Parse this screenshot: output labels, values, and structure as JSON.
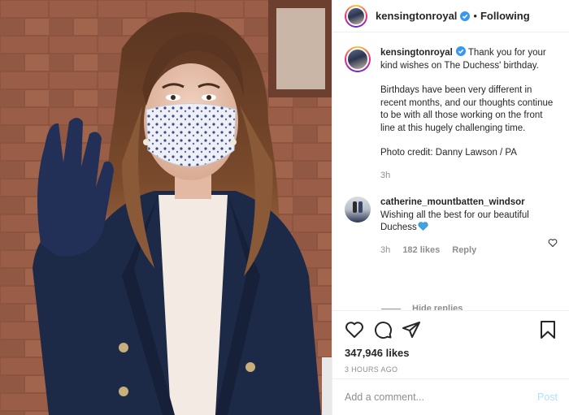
{
  "post": {
    "username": "kensingtonroyal",
    "separator": "•",
    "follow_status": "Following",
    "caption": {
      "username": "kensingtonroyal",
      "paragraphs": [
        "Thank you for your kind wishes on The Duchess' birthday.",
        "Birthdays have been very different in recent months, and our thoughts continue to be with all those working on the front line at this hugely challenging time.",
        "Photo credit: Danny Lawson / PA"
      ],
      "time": "3h"
    },
    "comments": [
      {
        "username": "catherine_mountbatten_windsor",
        "text": "Wishing all the best for our beautiful Duchess",
        "time": "3h",
        "likes": "182 likes",
        "reply_label": "Reply"
      }
    ],
    "hide_replies_label": "Hide replies",
    "likes_count": "347,946 likes",
    "timestamp": "3 HOURS AGO",
    "add_comment_placeholder": "Add a comment...",
    "post_button": "Post"
  },
  "icons": {
    "verified": "verified-badge-icon",
    "heart": "heart-icon",
    "comment": "comment-icon",
    "share": "share-icon",
    "bookmark": "bookmark-icon",
    "emoji": "blue-heart-emoji"
  },
  "colors": {
    "verified_blue": "#3897f0",
    "muted_text": "#8e8e8e",
    "post_button": "#b2dffc",
    "divider": "#efefef"
  }
}
